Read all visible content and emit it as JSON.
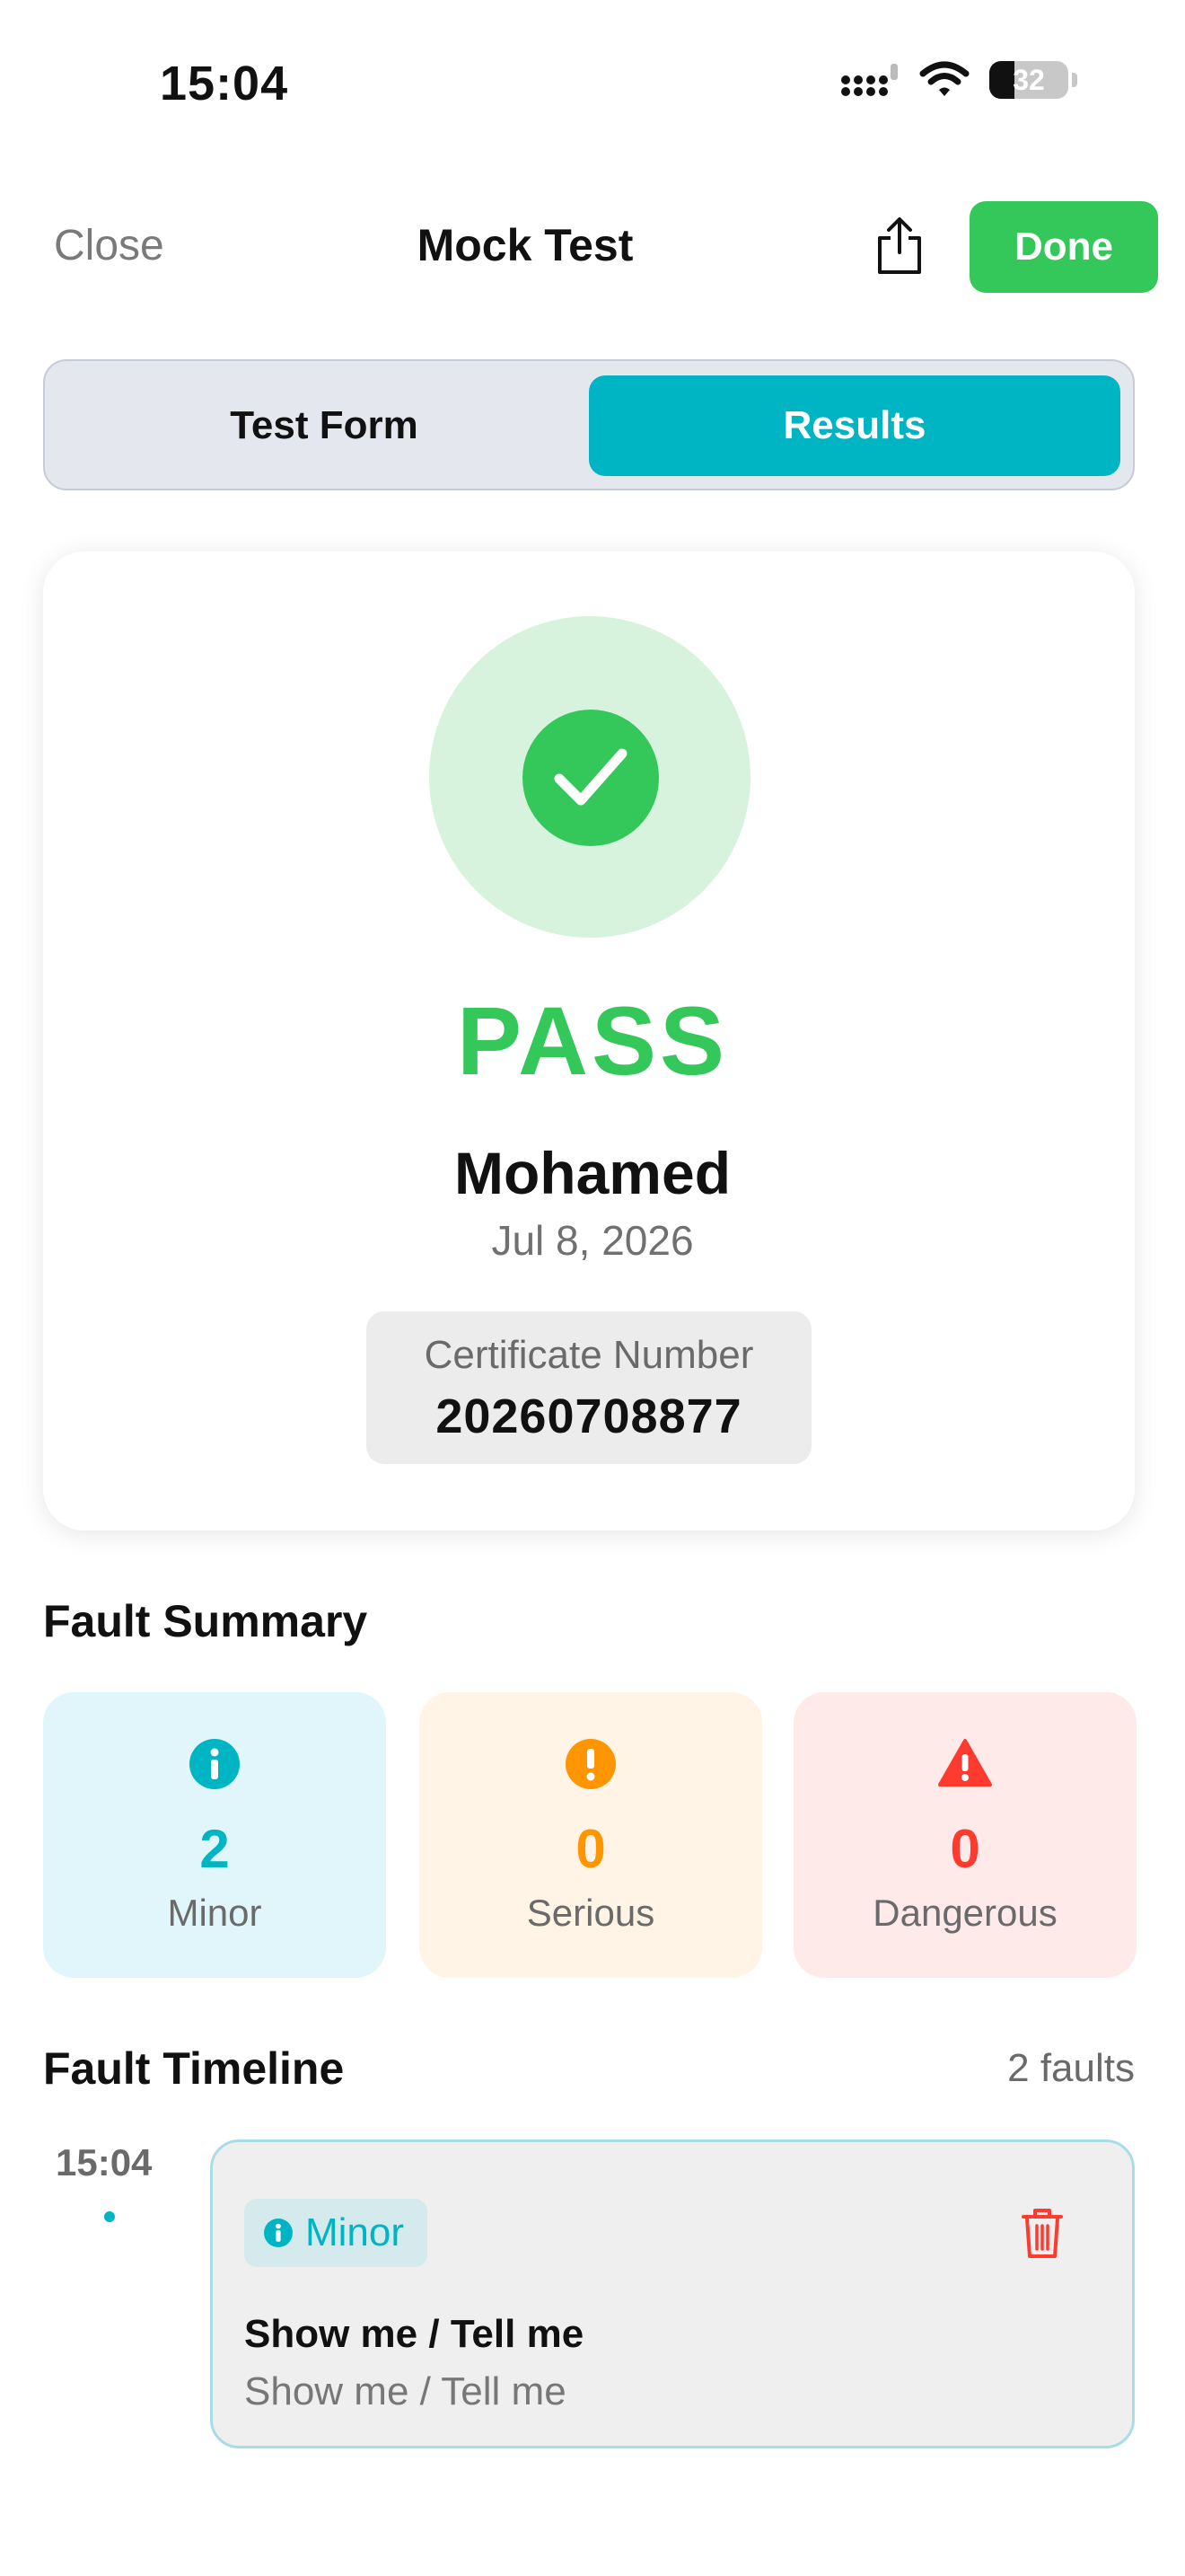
{
  "status_bar": {
    "time": "15:04",
    "battery": "32"
  },
  "nav": {
    "close_label": "Close",
    "title": "Mock Test",
    "done_label": "Done"
  },
  "tabs": [
    {
      "label": "Test Form",
      "selected": false
    },
    {
      "label": "Results",
      "selected": true
    }
  ],
  "result": {
    "status": "PASS",
    "candidate_name": "Mohamed",
    "date": "Jul 8, 2026",
    "certificate_label": "Certificate Number",
    "certificate_number": "20260708877"
  },
  "fault_summary": {
    "title": "Fault Summary",
    "items": [
      {
        "count": "2",
        "label": "Minor",
        "color": "#00b5c3",
        "icon": "info-icon"
      },
      {
        "count": "0",
        "label": "Serious",
        "color": "#ff9500",
        "icon": "exclamation-icon"
      },
      {
        "count": "0",
        "label": "Dangerous",
        "color": "#ff3b30",
        "icon": "warning-triangle-icon"
      }
    ]
  },
  "fault_timeline": {
    "title": "Fault Timeline",
    "count_label": "2 faults",
    "entries": [
      {
        "time": "15:04",
        "severity": "Minor",
        "title": "Show me / Tell me",
        "subtitle": "Show me / Tell me"
      }
    ]
  },
  "colors": {
    "accent": "#00b5c3",
    "pass": "#34c759",
    "serious": "#ff9500",
    "danger": "#ff3b30"
  }
}
